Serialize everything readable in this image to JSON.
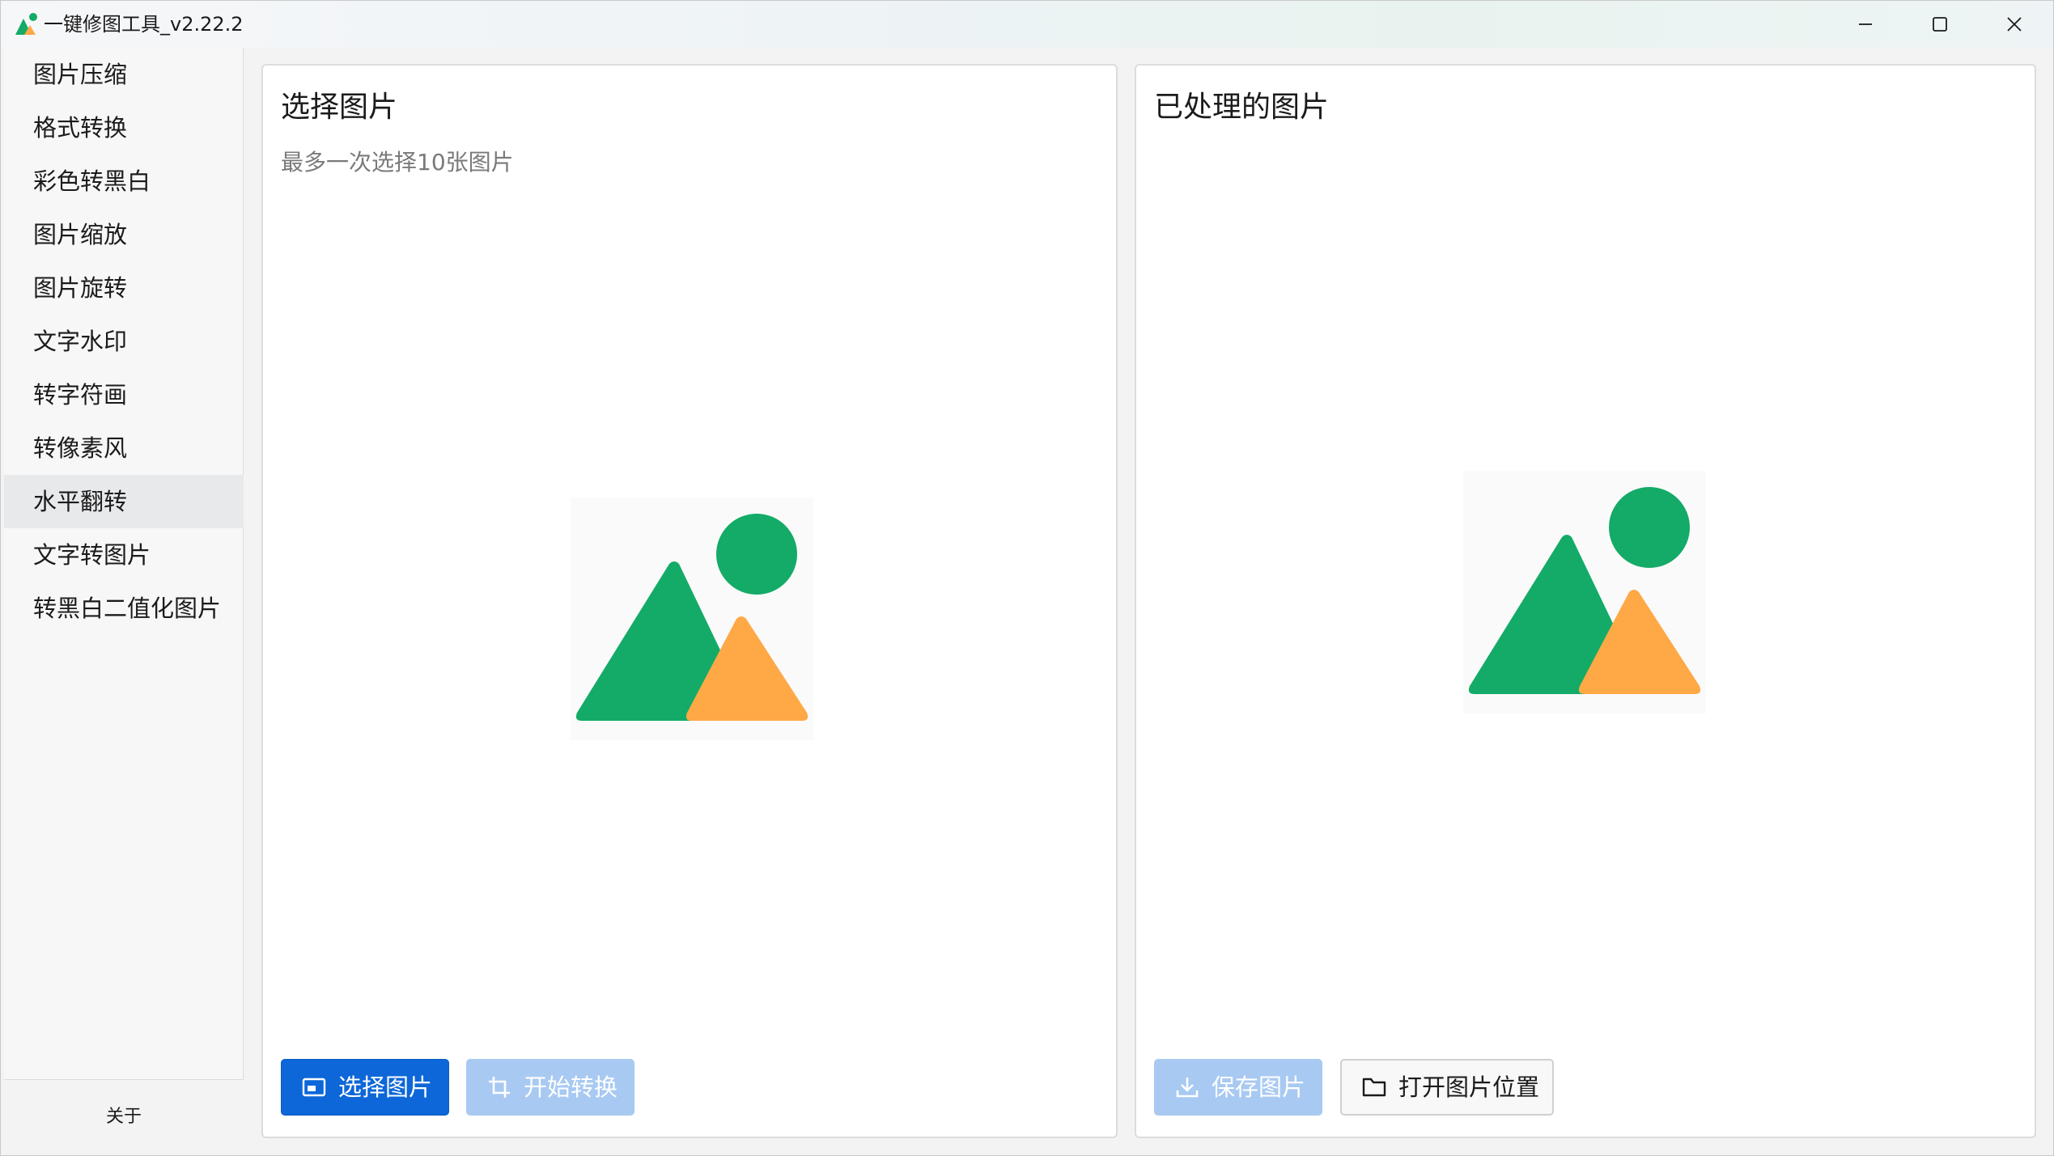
{
  "window": {
    "title": "一键修图工具_v2.22.2"
  },
  "sidebar": {
    "items": [
      {
        "label": "图片压缩"
      },
      {
        "label": "格式转换"
      },
      {
        "label": "彩色转黑白"
      },
      {
        "label": "图片缩放"
      },
      {
        "label": "图片旋转"
      },
      {
        "label": "文字水印"
      },
      {
        "label": "转字符画"
      },
      {
        "label": "转像素风"
      },
      {
        "label": "水平翻转",
        "active": true
      },
      {
        "label": "文字转图片"
      },
      {
        "label": "转黑白二值化图片"
      }
    ],
    "about_label": "关于"
  },
  "left_panel": {
    "title": "选择图片",
    "subtitle": "最多一次选择10张图片",
    "select_button": "选择图片",
    "start_button": "开始转换"
  },
  "right_panel": {
    "title": "已处理的图片",
    "save_button": "保存图片",
    "open_location_button": "打开图片位置"
  },
  "colors": {
    "accent": "#0d67d8",
    "accent_disabled": "#a8c9f2",
    "placeholder_green": "#13ab67",
    "placeholder_orange": "#ffa846"
  }
}
